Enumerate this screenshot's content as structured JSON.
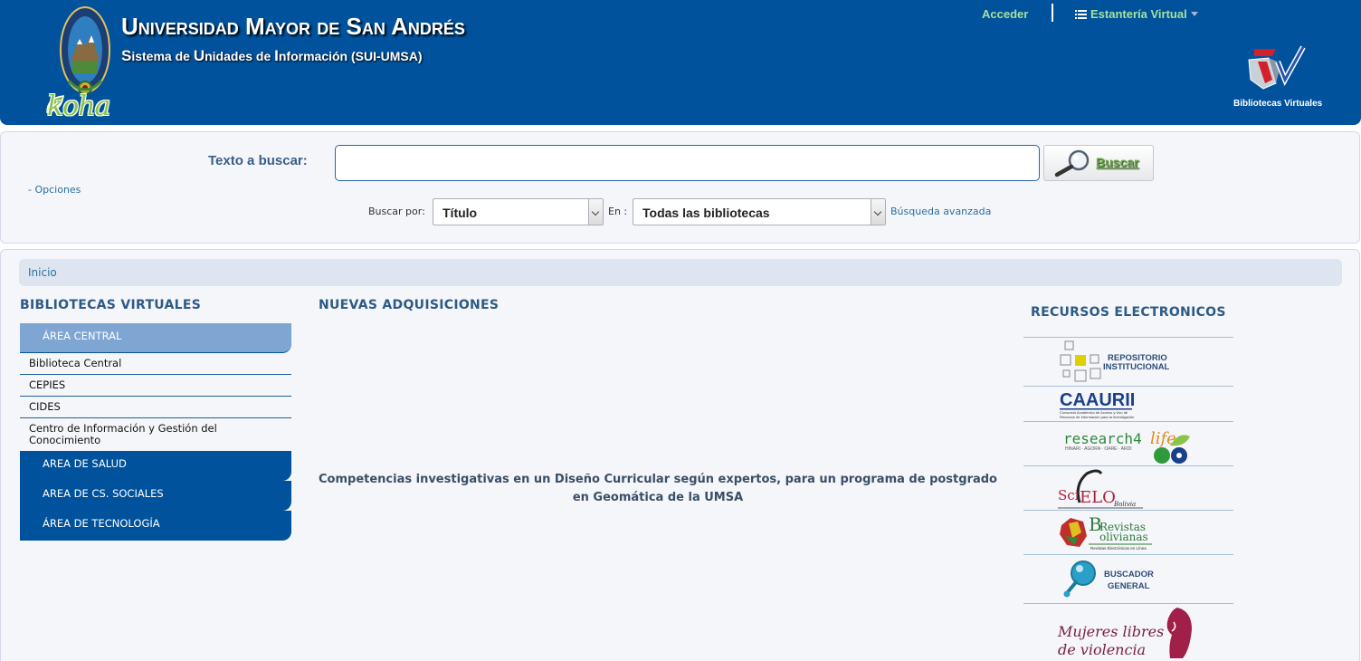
{
  "header": {
    "title": "Universidad Mayor de San Andrés",
    "subtitle_parts": [
      {
        "cap": "S",
        "rest": "istema de "
      },
      {
        "cap": "U",
        "rest": "nidades de "
      },
      {
        "cap": "I",
        "rest": "nformación (SUI-UMSA)"
      }
    ],
    "koha_logo_text": "koha",
    "acceder": "Acceder",
    "estanteria": "Estantería Virtual",
    "bv_logo_label": "Bibliotecas Virtuales"
  },
  "search": {
    "label": "Texto a buscar:",
    "value": "",
    "button": "Buscar",
    "opciones": "- Opciones",
    "buscar_por_label": "Buscar por:",
    "buscar_por_value": "Título",
    "en_label": "En :",
    "bibliotecas_value": "Todas las bibliotecas",
    "advanced": "Búsqueda avanzada"
  },
  "breadcrumb": {
    "home": "Inicio"
  },
  "virtual_libraries": {
    "title": "BIBLIOTECAS VIRTUALES",
    "groups": [
      {
        "label": "ÁREA CENTRAL",
        "expanded": true,
        "items": [
          "Biblioteca Central",
          "CEPIES",
          "CIDES",
          "Centro de Información y Gestión del Conocimiento"
        ]
      },
      {
        "label": "AREA DE SALUD",
        "expanded": false
      },
      {
        "label": "AREA DE CS. SOCIALES",
        "expanded": false
      },
      {
        "label": "ÁREA DE TECNOLOGÍA",
        "expanded": false
      }
    ]
  },
  "acquisitions": {
    "title": "NUEVAS ADQUISICIONES",
    "featured": "Competencias investigativas en un Diseño Curricular según expertos, para un programa de postgrado en Geomática de la UMSA"
  },
  "resources": {
    "title": "RECURSOS ELECTRONICOS",
    "repositorio": {
      "line1": "REPOSITORIO",
      "line2": "INSTITUCIONAL"
    },
    "caaurii": {
      "name": "CAAURII",
      "tagline1": "Consorcio Académico de Acceso y Uso de",
      "tagline2": "Recursos de Información para la Investigación"
    },
    "research4life": {
      "name_a": "research4",
      "name_b": "life",
      "tagline": "HINARI · AGORA · OARE · ARDI"
    },
    "scielo": {
      "a": "Sci",
      "b": "ELO",
      "c": "Bolivia"
    },
    "revistas": {
      "a": "Revistas",
      "b": "olivianas",
      "tagline": "Revistas Electrónicas en Línea"
    },
    "buscador": {
      "line1": "BUSCADOR",
      "line2": "GENERAL"
    },
    "mujeres": {
      "line1": "Mujeres libres",
      "line2": "de violencia"
    }
  },
  "colors": {
    "header_blue": "#00529c",
    "accent_green": "#a6e0a0",
    "section_title": "#2e5a86",
    "link": "#2b6ea0",
    "menu_active": "#7fa5d2"
  }
}
